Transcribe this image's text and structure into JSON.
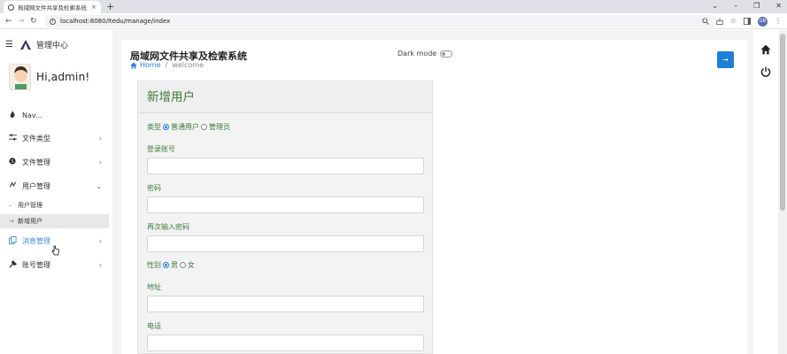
{
  "browser": {
    "tab_title": "局域网文件共享及检索系统",
    "tab_close": "×",
    "new_tab": "+",
    "url": "localhost:8080/ltedu/manage/index",
    "profile_initials": "GB",
    "win_min": "–",
    "win_max": "❐",
    "win_close": "✕"
  },
  "sidebar": {
    "brand": "管理中心",
    "greeting": "Hi,admin!",
    "items": [
      {
        "label": "Nav...",
        "icon": "fire-icon"
      },
      {
        "label": "文件类型",
        "icon": "sliders-icon"
      },
      {
        "label": "文件管理",
        "icon": "skype-icon"
      },
      {
        "label": "用户管理",
        "icon": "network-icon"
      },
      {
        "label": "消息管理",
        "icon": "copy-icon"
      },
      {
        "label": "账号管理",
        "icon": "tool-icon"
      }
    ],
    "subitems": [
      {
        "label": "用户管理"
      },
      {
        "label": "新增用户"
      }
    ]
  },
  "header": {
    "title": "局域网文件共享及检索系统",
    "breadcrumb_home": "Home",
    "breadcrumb_sep": "/",
    "breadcrumb_current": "welcome",
    "dark_mode_label": "Dark mode",
    "action_arrow": "→"
  },
  "form": {
    "title": "新增用户",
    "type_label": "类型",
    "type_options": [
      "普通用户",
      "管理员"
    ],
    "account_label": "登录账号",
    "password_label": "密码",
    "confirm_label": "再次输入密码",
    "gender_label": "性别",
    "gender_options": [
      "男",
      "女"
    ],
    "address_label": "地址",
    "phone_label": "电话"
  },
  "colors": {
    "accent": "#1e7fd8",
    "form_text": "#3e7a3e",
    "highlight_nav": "#3b8fd8"
  }
}
